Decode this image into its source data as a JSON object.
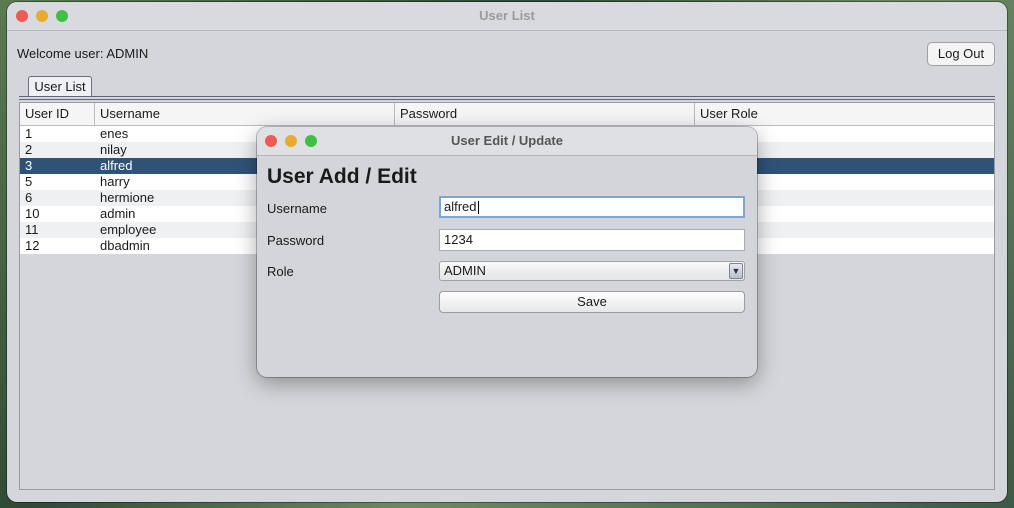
{
  "window": {
    "title": "User List"
  },
  "header": {
    "welcome_text": "Welcome user: ADMIN",
    "logout_label": "Log Out"
  },
  "tabs": [
    {
      "label": "User List"
    }
  ],
  "table": {
    "columns": [
      "User ID",
      "Username",
      "Password",
      "User Role"
    ],
    "rows": [
      {
        "id": "1",
        "username": "enes"
      },
      {
        "id": "2",
        "username": "nilay"
      },
      {
        "id": "3",
        "username": "alfred"
      },
      {
        "id": "5",
        "username": "harry"
      },
      {
        "id": "6",
        "username": "hermione"
      },
      {
        "id": "10",
        "username": "admin"
      },
      {
        "id": "11",
        "username": "employee"
      },
      {
        "id": "12",
        "username": "dbadmin"
      }
    ],
    "selected_row_index": 2
  },
  "dialog": {
    "title": "User Edit / Update",
    "heading": "User Add / Edit",
    "username_label": "Username",
    "username_value": "alfred",
    "password_label": "Password",
    "password_value": "1234",
    "role_label": "Role",
    "role_value": "ADMIN",
    "save_label": "Save"
  },
  "colors": {
    "selection": "#2f5377",
    "focus_ring": "#7aa7d8"
  },
  "icons": {
    "close": "close-icon",
    "minimize": "minimize-icon",
    "zoom": "zoom-icon",
    "dropdown": "chevron-down-icon"
  }
}
